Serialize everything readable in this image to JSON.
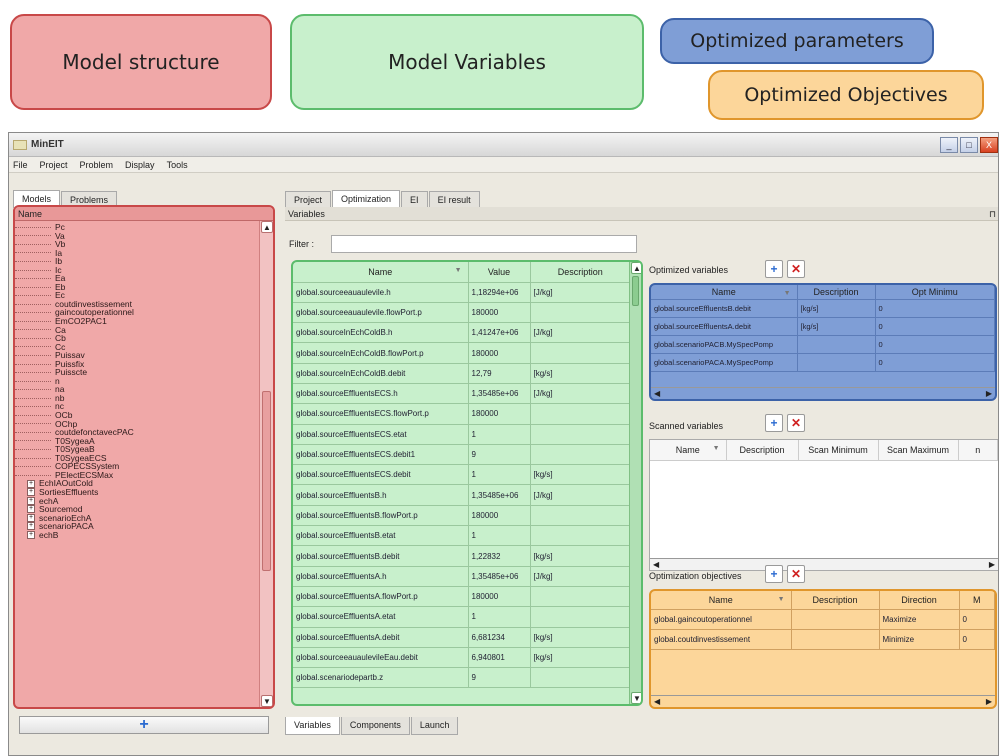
{
  "callouts": {
    "structure": "Model structure",
    "variables": "Model Variables",
    "opt_params": "Optimized parameters",
    "opt_objectives": "Optimized Objectives"
  },
  "window": {
    "title": "MinEIT",
    "controls": [
      "_",
      "□",
      "X"
    ]
  },
  "menu": [
    "File",
    "Project",
    "Problem",
    "Display",
    "Tools"
  ],
  "left_tabs": [
    "Models",
    "Problems"
  ],
  "left_panel": {
    "header": "Name",
    "leaves": [
      "Pc",
      "Va",
      "Vb",
      "Ia",
      "Ib",
      "Ic",
      "Ea",
      "Eb",
      "Ec",
      "coutdinvestissement",
      "gaincoutoperationnel",
      "EmCO2PAC1",
      "Ca",
      "Cb",
      "Cc",
      "Puissav",
      "Puissfix",
      "Puisscte",
      "n",
      "na",
      "nb",
      "nc",
      "OCb",
      "OChp",
      "coutdefonctavecPAC",
      "T0SygeaA",
      "T0SygeaB",
      "T0SygeaECS",
      "COPECSSystem",
      "PElectECSMax"
    ],
    "groups": [
      "EchIAOutCold",
      "SortiesEffluents",
      "echA",
      "Sourcemod",
      "scenarioEchA",
      "scenarioPACA",
      "echB"
    ],
    "expand_icon": "+",
    "add_button": "+"
  },
  "right_tabs": [
    "Project",
    "Optimization",
    "EI",
    "EI result"
  ],
  "variables_header": "Variables",
  "filter_label": "Filter :",
  "filter_value": "",
  "variables_table": {
    "columns": [
      "Name",
      "Value",
      "Description"
    ],
    "rows": [
      [
        "global.sourceeauaulevile.h",
        "1,18294e+06",
        "[J/kg]"
      ],
      [
        "global.sourceeauaulevile.flowPort.p",
        "180000",
        ""
      ],
      [
        "global.sourceInEchColdB.h",
        "1,41247e+06",
        "[J/kg]"
      ],
      [
        "global.sourceInEchColdB.flowPort.p",
        "180000",
        ""
      ],
      [
        "global.sourceInEchColdB.debit",
        "12,79",
        "[kg/s]"
      ],
      [
        "global.sourceEffluentsECS.h",
        "1,35485e+06",
        "[J/kg]"
      ],
      [
        "global.sourceEffluentsECS.flowPort.p",
        "180000",
        ""
      ],
      [
        "global.sourceEffluentsECS.etat",
        "1",
        ""
      ],
      [
        "global.sourceEffluentsECS.debit1",
        "9",
        ""
      ],
      [
        "global.sourceEffluentsECS.debit",
        "1",
        "[kg/s]"
      ],
      [
        "global.sourceEffluentsB.h",
        "1,35485e+06",
        "[J/kg]"
      ],
      [
        "global.sourceEffluentsB.flowPort.p",
        "180000",
        ""
      ],
      [
        "global.sourceEffluentsB.etat",
        "1",
        ""
      ],
      [
        "global.sourceEffluentsB.debit",
        "1,22832",
        "[kg/s]"
      ],
      [
        "global.sourceEffluentsA.h",
        "1,35485e+06",
        "[J/kg]"
      ],
      [
        "global.sourceEffluentsA.flowPort.p",
        "180000",
        ""
      ],
      [
        "global.sourceEffluentsA.etat",
        "1",
        ""
      ],
      [
        "global.sourceEffluentsA.debit",
        "6,681234",
        "[kg/s]"
      ],
      [
        "global.sourceeauaulevileEau.debit",
        "6,940801",
        "[kg/s]"
      ],
      [
        "global.scenariodepartb.z",
        "9",
        ""
      ]
    ]
  },
  "optimized_variables": {
    "label": "Optimized variables",
    "columns": [
      "Name",
      "Description",
      "Opt Minimu"
    ],
    "rows": [
      [
        "global.sourceEffluentsB.debit",
        "[kg/s]",
        "0"
      ],
      [
        "global.sourceEffluentsA.debit",
        "[kg/s]",
        "0"
      ],
      [
        "global.scenarioPACB.MySpecPomp",
        "",
        "0"
      ],
      [
        "global.scenarioPACA.MySpecPomp",
        "",
        "0"
      ]
    ]
  },
  "scanned_variables": {
    "label": "Scanned variables",
    "columns": [
      "Name",
      "Description",
      "Scan Minimum",
      "Scan Maximum",
      "n"
    ]
  },
  "objectives": {
    "label": "Optimization objectives",
    "columns": [
      "Name",
      "Description",
      "Direction",
      "M"
    ],
    "rows": [
      [
        "global.gaincoutoperationnel",
        "",
        "Maximize",
        "0"
      ],
      [
        "global.coutdinvestissement",
        "",
        "Minimize",
        "0"
      ]
    ]
  },
  "bottom_tabs": [
    "Variables",
    "Components",
    "Launch"
  ],
  "buttons": {
    "add": "+",
    "remove": "✕"
  },
  "colors": {
    "structure": "#f0a8a8",
    "variables": "#c8f0cc",
    "params": "#7f9ed6",
    "objectives": "#fcd69a"
  }
}
